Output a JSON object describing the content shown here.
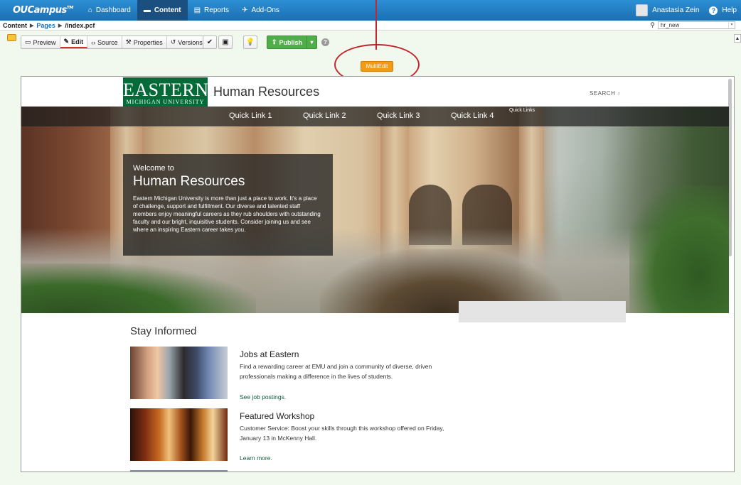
{
  "topbar": {
    "logo": "OUCampus",
    "logo_tm": "TM",
    "nav": [
      {
        "label": "Dashboard",
        "icon": "home-icon"
      },
      {
        "label": "Content",
        "icon": "folder-icon"
      },
      {
        "label": "Reports",
        "icon": "report-icon"
      },
      {
        "label": "Add-Ons",
        "icon": "pin-icon"
      }
    ],
    "user": "Anastasia Zein",
    "help": "Help"
  },
  "breadcrumb": {
    "content": "Content",
    "pages": "Pages",
    "file": "/index.pcf",
    "site": "hr_new"
  },
  "toolbar": {
    "preview": "Preview",
    "edit": "Edit",
    "source": "Source",
    "properties": "Properties",
    "versions": "Versions",
    "publish": "Publish",
    "multiedit": "MultiEdit"
  },
  "site": {
    "logo_main": "EASTERN",
    "logo_sub": "MICHIGAN UNIVERSITY",
    "title": "Human Resources",
    "search": "SEARCH"
  },
  "quicklinks": {
    "header": "Quick Links",
    "items": [
      "Quick Link 1",
      "Quick Link 2",
      "Quick Link 3",
      "Quick Link 4"
    ]
  },
  "welcome": {
    "pre": "Welcome to",
    "title": "Human Resources",
    "body": "Eastern Michigan University is more than just a place to work. It's a place of challenge, support and fulfillment. Our diverse and talented staff members enjoy meaningful careers as they rub shoulders with outstanding faculty and our bright, inquisitive students. Consider joining us and see where an inspiring Eastern career takes you."
  },
  "stay": {
    "title": "Stay Informed",
    "cards": [
      {
        "title": "Jobs at Eastern",
        "desc": "Find a rewarding career at EMU and join a community of diverse, driven professionals making a difference in the lives of students.",
        "link": "See job postings."
      },
      {
        "title": "Featured Workshop",
        "desc": "Customer Service: Boost your skills through this workshop offered on Friday, January 13 in McKenny Hall.",
        "link": "Learn more."
      }
    ]
  },
  "colors": {
    "topbar": "#1b6fb1",
    "emu_green": "#046a38",
    "publish_green": "#4fae49",
    "multiedit_orange": "#f29b16",
    "annotation_red": "#c0282e"
  }
}
